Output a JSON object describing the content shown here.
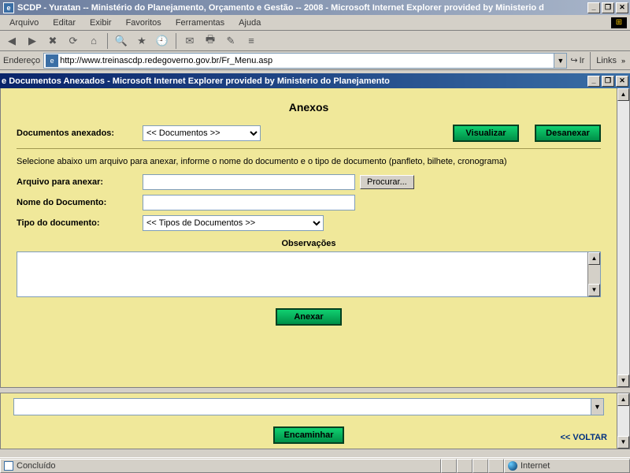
{
  "main_window": {
    "title": "SCDP - Yuratan -- Ministério do Planejamento, Orçamento e Gestão -- 2008 - Microsoft Internet Explorer provided by Ministerio d",
    "menus": [
      "Arquivo",
      "Editar",
      "Exibir",
      "Favoritos",
      "Ferramentas",
      "Ajuda"
    ]
  },
  "addressbar": {
    "label": "Endereço",
    "url": "http://www.treinascdp.redegoverno.gov.br/Fr_Menu.asp",
    "go": "Ir",
    "links": "Links"
  },
  "sub_window": {
    "title": "Documentos Anexados - Microsoft Internet Explorer provided by Ministerio do Planejamento"
  },
  "form": {
    "page_title": "Anexos",
    "docs_label": "Documentos anexados:",
    "docs_select": "<< Documentos >>",
    "btn_visualizar": "Visualizar",
    "btn_desanexar": "Desanexar",
    "instruction": "Selecione abaixo um arquivo para anexar, informe o nome do documento e o tipo de documento (panfleto, bilhete, cronograma)",
    "arquivo_label": "Arquivo para anexar:",
    "browse_btn": "Procurar...",
    "nome_label": "Nome do Documento:",
    "tipo_label": "Tipo do documento:",
    "tipo_select": "<< Tipos de Documentos >>",
    "obs_label": "Observações",
    "btn_anexar": "Anexar"
  },
  "lower": {
    "btn_encaminhar": "Encaminhar",
    "voltar": "<< VOLTAR"
  },
  "statusbar": {
    "status": "Concluído",
    "zone": "Internet"
  }
}
